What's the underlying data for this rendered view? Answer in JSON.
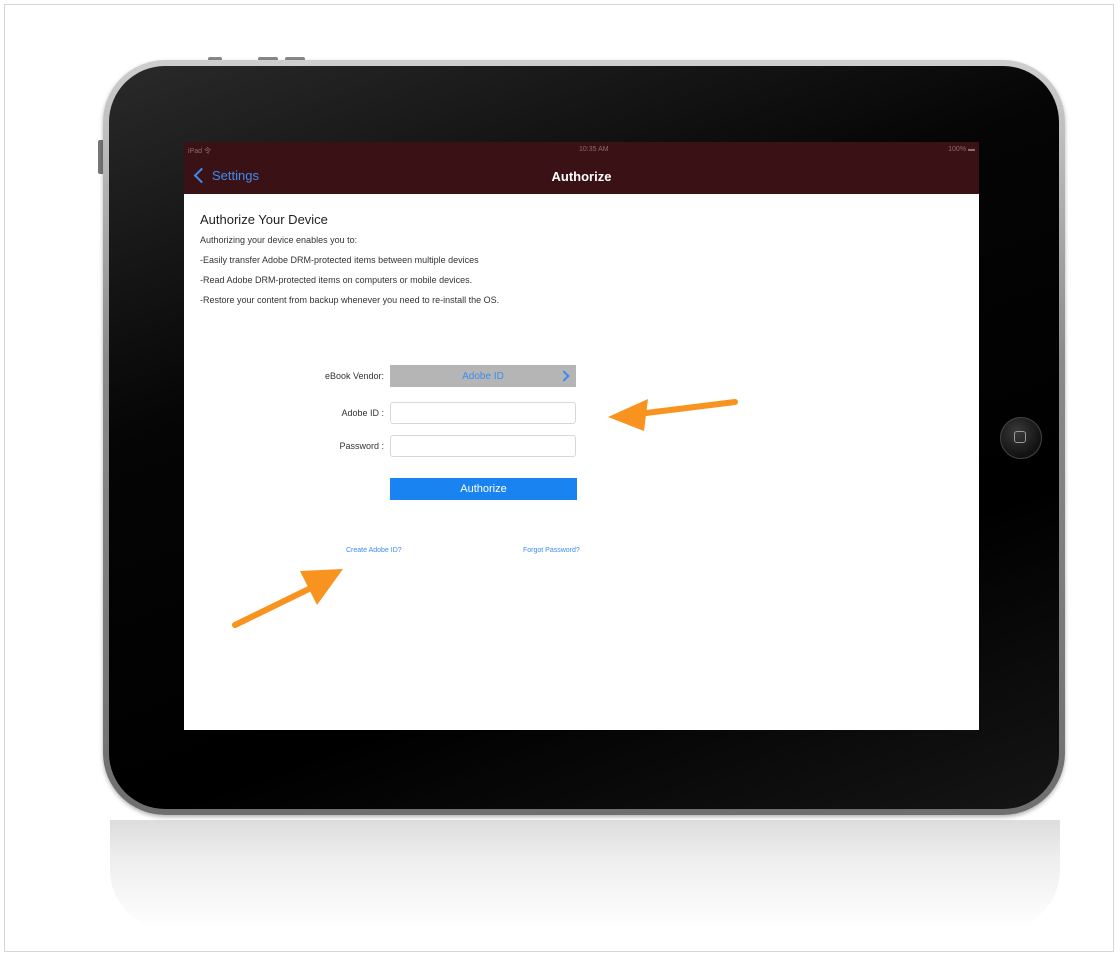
{
  "status_bar": {
    "left": "iPad 令",
    "center": "10:35 AM",
    "right": "100% ▬"
  },
  "nav": {
    "back_label": "Settings",
    "title": "Authorize"
  },
  "intro": {
    "heading": "Authorize Your Device",
    "lines": [
      "Authorizing your device enables you to:",
      "-Easily transfer Adobe DRM-protected items between multiple devices",
      "-Read Adobe DRM-protected items on computers or mobile devices.",
      "-Restore your content from backup whenever you need to re-install the OS."
    ]
  },
  "form": {
    "vendor_label": "eBook Vendor:",
    "vendor_value": "Adobe ID",
    "id_label": "Adobe ID :",
    "id_value": "",
    "password_label": "Password :",
    "password_value": "",
    "authorize_label": "Authorize"
  },
  "links": {
    "create": "Create Adobe ID?",
    "forgot": "Forgot Password?"
  },
  "colors": {
    "nav_bg": "#3a1216",
    "accent": "#1a83f2",
    "arrow": "#f7931e"
  }
}
